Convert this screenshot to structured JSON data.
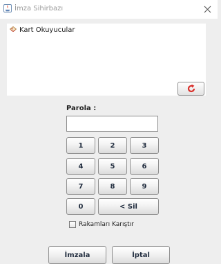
{
  "window": {
    "title": "İmza Sihirbazı",
    "app_icon": "java-icon",
    "close_icon": "close-icon"
  },
  "reader_list": {
    "items": [
      {
        "label": "Kart Okuyucular",
        "icon": "card-reader-icon"
      }
    ],
    "refresh_icon": "refresh-icon",
    "refresh_icon_color": "#d9302b"
  },
  "password": {
    "label": "Parola :",
    "value": "",
    "placeholder": ""
  },
  "keypad": {
    "k1": "1",
    "k2": "2",
    "k3": "3",
    "k4": "4",
    "k5": "5",
    "k6": "6",
    "k7": "7",
    "k8": "8",
    "k9": "9",
    "k0": "0",
    "delete": "< Sil"
  },
  "shuffle": {
    "label": "Rakamları Karıştır",
    "checked": false
  },
  "actions": {
    "sign": "İmzala",
    "cancel": "İptal"
  },
  "colors": {
    "background": "#eeeeee",
    "panel": "#ffffff",
    "button_text": "#1f2b3d",
    "button_border": "#8f8f8f"
  }
}
